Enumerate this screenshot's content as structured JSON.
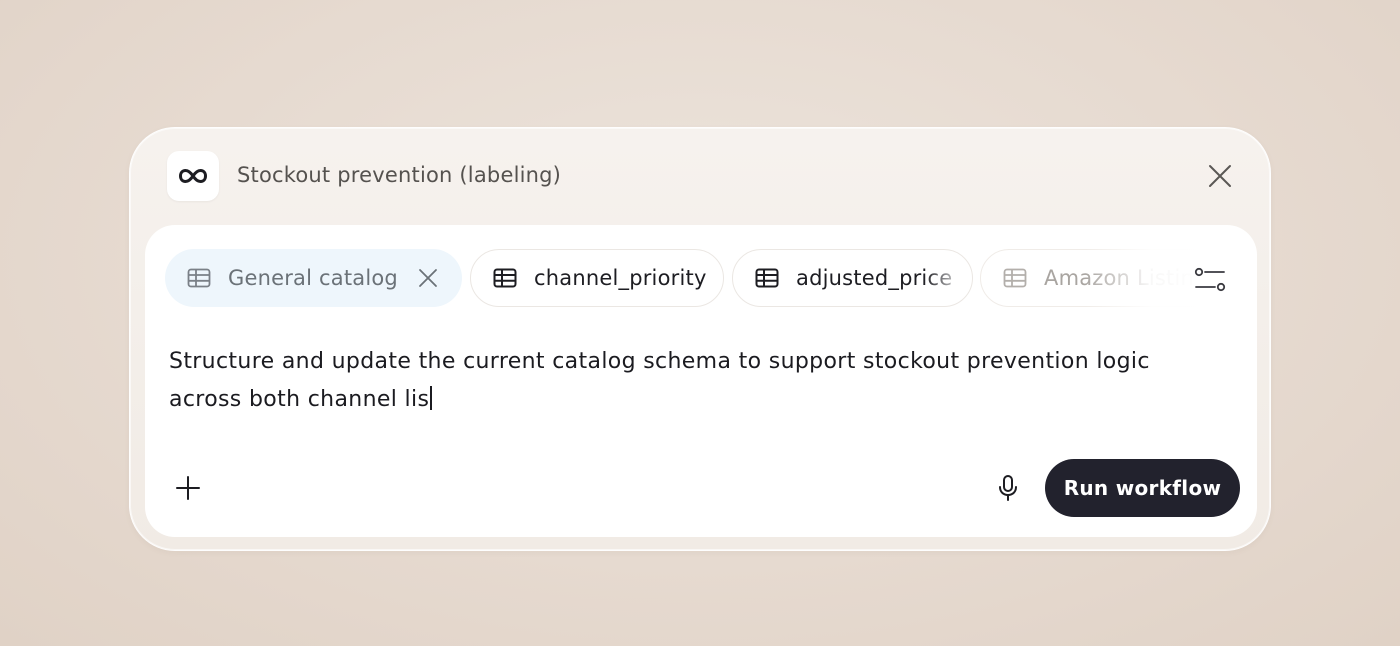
{
  "header": {
    "title": "Stockout prevention (labeling)",
    "logo_icon": "infinity-icon",
    "close_icon": "close-icon"
  },
  "chips": [
    {
      "label": "General catalog",
      "icon": "table-icon",
      "state": "selected",
      "removable": true
    },
    {
      "label": "channel_priority",
      "icon": "table-icon",
      "state": "default"
    },
    {
      "label": "adjusted_price",
      "icon": "table-icon",
      "state": "default"
    },
    {
      "label": "Amazon Listin",
      "icon": "table-icon",
      "state": "faded"
    }
  ],
  "filter_icon": "sliders-icon",
  "prompt": {
    "text": "Structure and update the current catalog schema to support stockout prevention logic across both channel lis"
  },
  "footer": {
    "add_icon": "plus-icon",
    "mic_icon": "microphone-icon",
    "run_label": "Run workflow"
  },
  "colors": {
    "background": "#e6dad0",
    "panel": "#f4efea",
    "card": "#ffffff",
    "chip_selected_bg": "#eef6fc",
    "run_button_bg": "#22222d",
    "text_primary": "#1b1b20"
  }
}
